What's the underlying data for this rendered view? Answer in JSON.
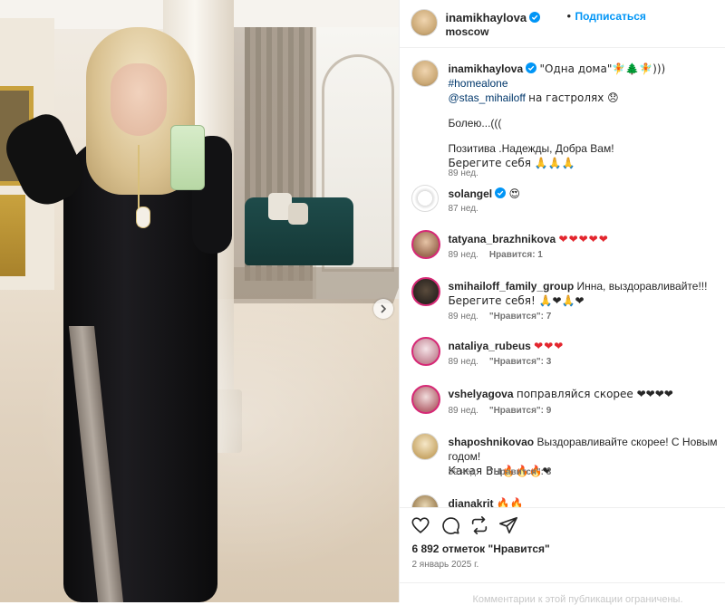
{
  "post": {
    "author": "inamikhaylova",
    "follow_label": "Подписаться",
    "location": "Moscow"
  },
  "comments": [
    {
      "user": "inamikhaylova",
      "text_a": "\"Одна дома\"🧚🌲🧚)))",
      "hashtag": "#homealone",
      "mention": "@stas_mihailoff",
      "text_b": "на гастролях 😞",
      "line2": "Болею...(((",
      "line3": "Позитива .Надежды, Добра Вам!",
      "line4": "Берегите себя 🙏🙏🙏",
      "time": "89 нед."
    },
    {
      "user": "solangel",
      "text": "😍",
      "time": "87 нед."
    },
    {
      "user": "tatyana_brazhnikova",
      "text": "❤❤❤❤❤",
      "time": "89 нед.",
      "likes": "Нравится: 1"
    },
    {
      "user": "smihailoff_family_group",
      "text": "Инна, выздоравливайте!!!",
      "line2": "Берегите себя! 🙏❤🙏❤",
      "time": "89 нед.",
      "likes": "\"Нравится\": 7"
    },
    {
      "user": "nataliya_rubeus",
      "text": "❤❤❤",
      "time": "89 нед.",
      "likes": "\"Нравится\": 3"
    },
    {
      "user": "vshelyagova",
      "text": "поправляйся скорее ❤❤❤❤",
      "time": "89 нед.",
      "likes": "\"Нравится\": 9"
    },
    {
      "user": "shaposhnikovao",
      "text": "Выздоравливайте скорее! С Новым годом!",
      "line2": "Какая Вы🔥🔥🔥❤",
      "time": "89 нед.",
      "likes": "\"Нравится\": 3"
    },
    {
      "user": "dianakrit",
      "text": "🔥🔥"
    }
  ],
  "actions": {
    "like_icon": "heart-icon",
    "comment_icon": "comment-icon",
    "repost_icon": "repost-icon",
    "share_icon": "share-icon"
  },
  "likes_text": "6 892 отметок \"Нравится\"",
  "date_text": "2 январь 2025 г.",
  "footer_text": "Комментарии к этой публикации ограничены.",
  "colors": {
    "accent": "#0095f6",
    "verified": "#0095f6",
    "text": "#262626",
    "muted": "#737373"
  }
}
